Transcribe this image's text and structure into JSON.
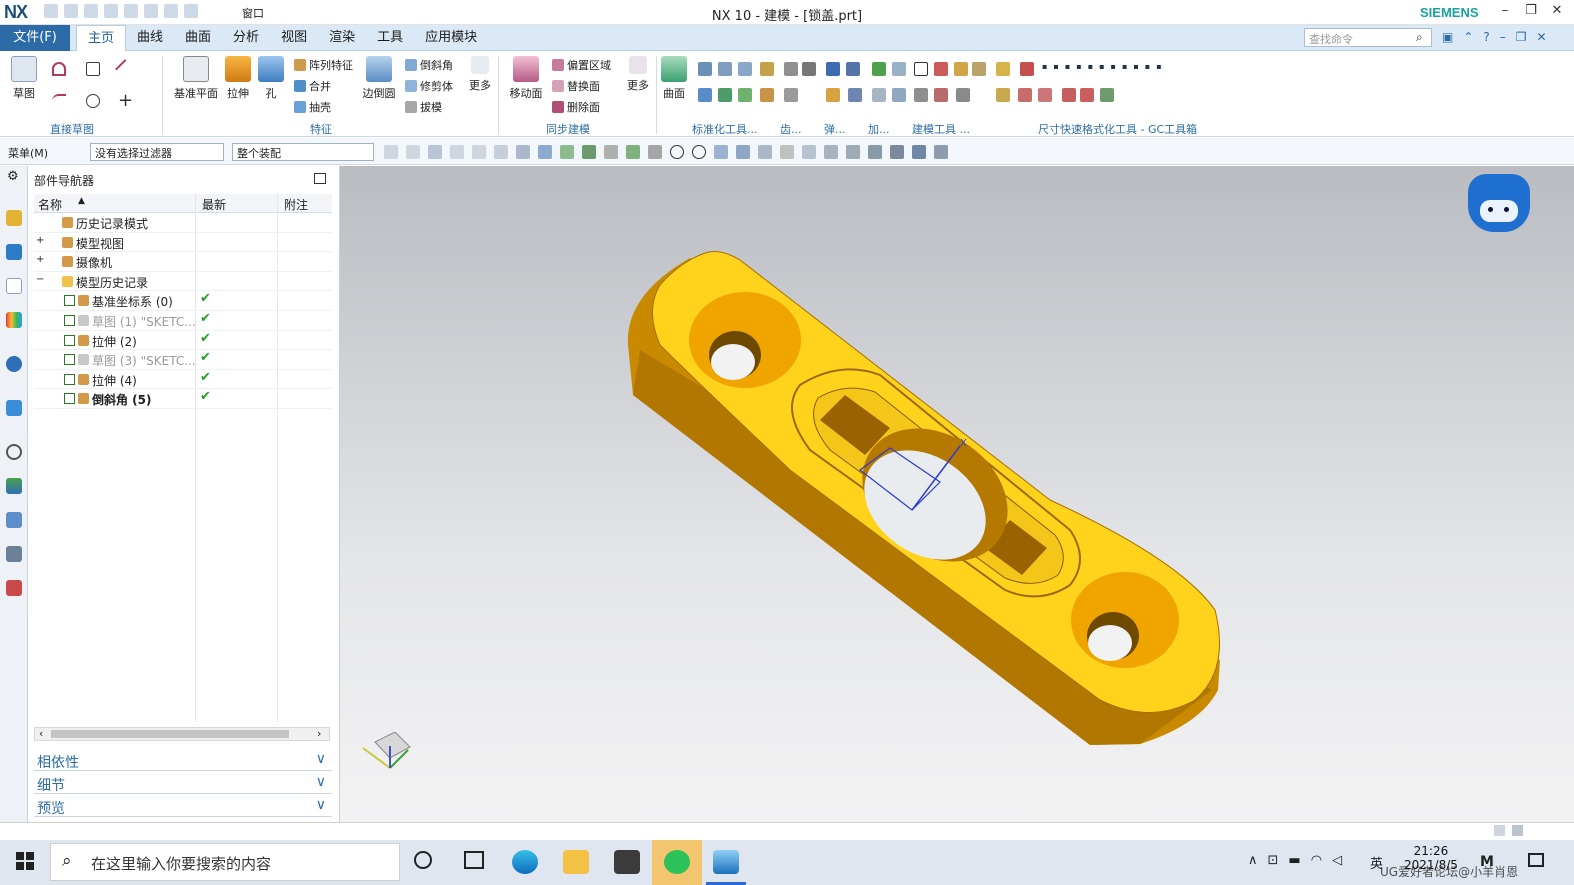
{
  "window": {
    "logo": "NX",
    "title": "NX 10 - 建模 - [锁盖.prt]",
    "brand": "SIEMENS",
    "quick_access_window": "窗口"
  },
  "menu": {
    "file": "文件(F)",
    "tabs": [
      "主页",
      "曲线",
      "曲面",
      "分析",
      "视图",
      "渲染",
      "工具",
      "应用模块"
    ],
    "active_tab": "主页",
    "search_placeholder": "查找命令"
  },
  "ribbon": {
    "direct_sketch": {
      "label": "直接草图",
      "sketch": "草图"
    },
    "feature": {
      "label": "特征",
      "datum_plane": "基准平面",
      "extrude": "拉伸",
      "hole": "孔",
      "pattern_feature": "阵列特征",
      "unite": "合并",
      "shell": "抽壳",
      "edge_blend": "边倒圆",
      "chamfer": "倒斜角",
      "trim_body": "修剪体",
      "draft": "拔模",
      "more": "更多"
    },
    "sync_modeling": {
      "label": "同步建模",
      "move_face": "移动面",
      "offset_region": "偏置区域",
      "replace_face": "替换面",
      "delete_face": "删除面",
      "more": "更多"
    },
    "surface": {
      "label": "曲面"
    },
    "group_labels": [
      "标准化工具...",
      "齿...",
      "弹...",
      "加...",
      "建模工具 ...",
      "尺寸快速格式化工具 - GC工具箱"
    ]
  },
  "selection_bar": {
    "menu": "菜单(M)",
    "filter": "没有选择过滤器",
    "scope": "整个装配"
  },
  "navigator": {
    "title": "部件导航器",
    "columns": [
      "名称",
      "最新",
      "附注"
    ],
    "rows": [
      {
        "label": "历史记录模式",
        "indent": 0,
        "checked": false,
        "tick": false
      },
      {
        "label": "模型视图",
        "indent": 0,
        "checked": false,
        "tick": false
      },
      {
        "label": "摄像机",
        "indent": 0,
        "checked": false,
        "tick": false
      },
      {
        "label": "模型历史记录",
        "indent": 0,
        "checked": false,
        "tick": false
      },
      {
        "label": "基准坐标系 (0)",
        "indent": 1,
        "checked": true,
        "tick": true
      },
      {
        "label": "草图 (1) \"SKETC...",
        "indent": 1,
        "checked": true,
        "tick": true,
        "muted": true
      },
      {
        "label": "拉伸 (2)",
        "indent": 1,
        "checked": true,
        "tick": true
      },
      {
        "label": "草图 (3) \"SKETC...",
        "indent": 1,
        "checked": true,
        "tick": true,
        "muted": true
      },
      {
        "label": "拉伸 (4)",
        "indent": 1,
        "checked": true,
        "tick": true
      },
      {
        "label": "倒斜角 (5)",
        "indent": 1,
        "checked": true,
        "tick": true,
        "bold": true
      }
    ],
    "panels": [
      "相依性",
      "细节",
      "预览"
    ]
  },
  "taskbar": {
    "search": "在这里输入你要搜索的内容",
    "ime": "英",
    "time": "21:26",
    "date": "2021/8/5",
    "watermark": "UG爱好者论坛@小羊肖恩"
  },
  "colors": {
    "part_face": "#ffd21c",
    "part_side": "#c98a00",
    "accent": "#2c6aa8"
  }
}
